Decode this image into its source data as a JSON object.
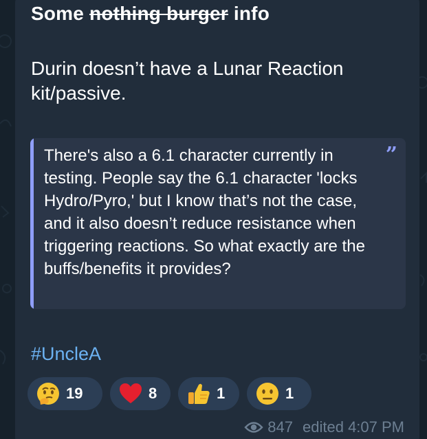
{
  "message": {
    "title_prefix": "Some ",
    "title_struck": "nothing burger",
    "title_suffix": " info",
    "paragraph": "Durin doesn’t have a Lunar Reaction kit/passive.",
    "quote_text": "There's also a 6.1 character currently in testing. People say the 6.1 character 'locks Hydro/Pyro,' but I know that’s not the case, and it also doesn’t reduce resistance when triggering reactions. So what exactly are the buffs/benefits it provides?",
    "quote_icon": "quote-icon",
    "hashtag": "#UncleA"
  },
  "reactions": [
    {
      "emoji": "thinking-face-icon",
      "count": "19"
    },
    {
      "emoji": "red-heart-icon",
      "count": "8"
    },
    {
      "emoji": "thumbs-up-icon",
      "count": "1"
    },
    {
      "emoji": "neutral-face-icon",
      "count": "1"
    }
  ],
  "footer": {
    "views_icon": "eye-icon",
    "views": "847",
    "edited_label": "edited 4:07 PM"
  },
  "colors": {
    "background": "#16212b",
    "bubble": "#212d3b",
    "quote_bg": "#2b3648",
    "quote_accent": "#8f9ef8",
    "link": "#6cb2f2",
    "reaction_pill": "#2c3e55",
    "meta_text": "#6d7f92"
  }
}
